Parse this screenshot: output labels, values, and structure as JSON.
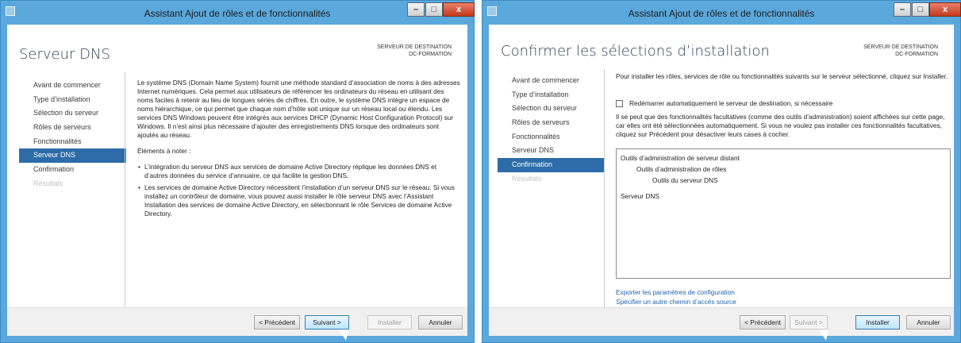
{
  "window1": {
    "title": "Assistant Ajout de rôles et de fonctionnalités",
    "heading": "Serveur DNS",
    "destination_label": "SERVEUR DE DESTINATION",
    "destination_server": "DC-FORMATION",
    "nav": [
      {
        "label": "Avant de commencer",
        "state": "normal"
      },
      {
        "label": "Type d’installation",
        "state": "normal"
      },
      {
        "label": "Sélection du serveur",
        "state": "normal"
      },
      {
        "label": "Rôles de serveurs",
        "state": "normal"
      },
      {
        "label": "Fonctionnalités",
        "state": "normal"
      },
      {
        "label": "Serveur DNS",
        "state": "active"
      },
      {
        "label": "Confirmation",
        "state": "normal"
      },
      {
        "label": "Résultats",
        "state": "disabled"
      }
    ],
    "intro": "Le système DNS (Domain Name System) fournit une méthode standard d’association de noms à des adresses Internet numériques. Cela permet aux utilisateurs de référencer les ordinateurs du réseau en utilisant des noms faciles à retenir au lieu de longues séries de chiffres. En outre, le système DNS intègre un espace de noms hiérarchique, ce qui permet que chaque nom d’hôte soit unique sur un réseau local ou étendu. Les services DNS Windows peuvent être intégrés aux services DHCP (Dynamic Host Configuration Protocol) sur Windows. Il n’est ainsi plus nécessaire d’ajouter des enregistrements DNS lorsque des ordinateurs sont ajoutés au réseau.",
    "notes_title": "Éléments à noter :",
    "notes": [
      "L’intégration du serveur DNS aux services de domaine Active Directory réplique les données DNS et d’autres données du service d’annuaire, ce qui facilite la gestion DNS.",
      "Les services de domaine Active Directory nécessitent l’installation d’un serveur DNS sur le réseau. Si vous installez un contrôleur de domaine, vous pouvez aussi installer le rôle serveur DNS avec l’Assistant Installation des services de domaine Active Directory, en sélectionnant le rôle Services de domaine Active Directory."
    ],
    "buttons": {
      "previous": "< Précédent",
      "next": "Suivant >",
      "install": "Installer",
      "cancel": "Annuler"
    }
  },
  "window2": {
    "title": "Assistant Ajout de rôles et de fonctionnalités",
    "heading": "Confirmer les sélections d’installation",
    "destination_label": "SERVEUR DE DESTINATION",
    "destination_server": "DC-FORMATION",
    "nav": [
      {
        "label": "Avant de commencer",
        "state": "normal"
      },
      {
        "label": "Type d’installation",
        "state": "normal"
      },
      {
        "label": "Sélection du serveur",
        "state": "normal"
      },
      {
        "label": "Rôles de serveurs",
        "state": "normal"
      },
      {
        "label": "Fonctionnalités",
        "state": "normal"
      },
      {
        "label": "Serveur DNS",
        "state": "normal"
      },
      {
        "label": "Confirmation",
        "state": "active"
      },
      {
        "label": "Résultats",
        "state": "disabled"
      }
    ],
    "intro": "Pour installer les rôles, services de rôle ou fonctionnalités suivants sur le serveur sélectionné, cliquez sur Installer.",
    "restart_label": "Redémarrer automatiquement le serveur de destination, si nécessaire",
    "restart_checked": false,
    "optional_note": "Il se peut que des fonctionnalités facultatives (comme des outils d’administration) soient affichées sur cette page, car elles ont été sélectionnées automatiquement. Si vous ne voulez pas installer ces fonctionnalités facultatives, cliquez sur Précédent pour désactiver leurs cases à cocher.",
    "selections": [
      {
        "label": "Outils d’administration de serveur distant",
        "level": 0
      },
      {
        "label": "Outils d’administration de rôles",
        "level": 1
      },
      {
        "label": "Outils du serveur DNS",
        "level": 2
      },
      {
        "label": "Serveur DNS",
        "level": 0
      }
    ],
    "links": {
      "export": "Exporter les paramètres de configuration",
      "source": "Spécifier un autre chemin d’accès source"
    },
    "buttons": {
      "previous": "< Précédent",
      "next": "Suivant >",
      "install": "Installer",
      "cancel": "Annuler"
    }
  },
  "colors": {
    "frame": "#5aa8dc",
    "nav_active": "#2d6ca8",
    "link": "#1f64b0",
    "close": "#c43b1e"
  }
}
